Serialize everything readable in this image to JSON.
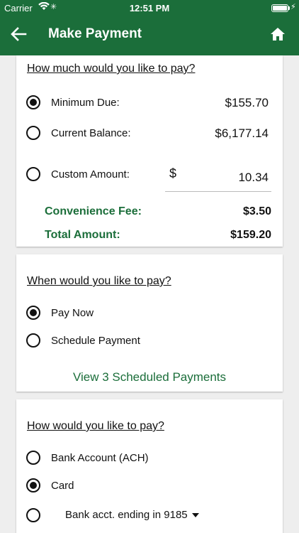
{
  "status_bar": {
    "carrier": "Carrier",
    "time": "12:51 PM"
  },
  "nav": {
    "title": "Make Payment",
    "back_icon": "arrow-left-icon",
    "home_icon": "home-icon"
  },
  "amount_section": {
    "heading": "How much would you like to pay?",
    "options": [
      {
        "label": "Minimum Due:",
        "value": "$155.70",
        "selected": true
      },
      {
        "label": "Current Balance:",
        "value": "$6,177.14",
        "selected": false
      },
      {
        "label": "Custom Amount:",
        "selected": false
      }
    ],
    "currency_symbol": "$",
    "custom_amount_value": "10.34",
    "convenience_fee_label": "Convenience Fee:",
    "convenience_fee_value": "$3.50",
    "total_label": "Total Amount:",
    "total_value": "$159.20"
  },
  "timing_section": {
    "heading": "When would you like to pay?",
    "options": [
      {
        "label": "Pay Now",
        "selected": true
      },
      {
        "label": "Schedule Payment",
        "selected": false
      }
    ],
    "scheduled_link": "View 3 Scheduled Payments"
  },
  "method_section": {
    "heading": "How would you like to pay?",
    "options": [
      {
        "label": "Bank Account (ACH)",
        "selected": false
      },
      {
        "label": "Card",
        "selected": true
      }
    ],
    "account_selected": "Bank acct. ending in 9185"
  },
  "colors": {
    "brand_green": "#1b6e3a",
    "background": "#eeeeee"
  }
}
